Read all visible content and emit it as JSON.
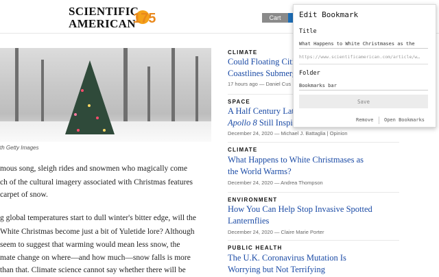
{
  "header": {
    "logo_line1": "SCIENTIFIC",
    "logo_line2": "AMERICAN",
    "logo_badge": "175",
    "cart_label": "Cart"
  },
  "article": {
    "caption": "th Getty Images",
    "paragraph1": [
      "mous song, sleigh rides and snowmen who magically come",
      "ch of the cultural imagery associated with Christmas features",
      "carpet of snow."
    ],
    "paragraph2": [
      "g global temperatures start to dull winter's bitter edge, will the",
      "White Christmas become just a bit of Yuletide lore? Although",
      "seem to suggest that warming would mean less snow, the",
      "mate change on where—and how much—snow falls is more",
      "than that. Climate science cannot say whether there will be"
    ]
  },
  "sidebar": {
    "items": [
      {
        "kicker": "CLIMATE",
        "headline": "Could Floating Citi… Coastlines Submerg…",
        "line1": "Could Floating Citi",
        "line2": "Coastlines Submerg",
        "meta": "17 hours ago — Daniel Cus"
      },
      {
        "kicker": "SPACE",
        "line1": "A Half Century Late",
        "line2a": "Apollo 8",
        "line2b": " Still Inspire",
        "meta": "December 24, 2020 — Michael J. Battaglia | Opinion"
      },
      {
        "kicker": "CLIMATE",
        "line1": "What Happens to White Christmases as",
        "line2": "the World Warms?",
        "meta": "December 24, 2020 — Andrea Thompson"
      },
      {
        "kicker": "ENVIRONMENT",
        "line1": "How You Can Help Stop Invasive Spotted",
        "line2": "Lanternflies",
        "meta": "December 24, 2020 — Claire Marie Porter"
      },
      {
        "kicker": "PUBLIC HEALTH",
        "line1": "The U.K. Coronavirus Mutation Is",
        "line2": "Worrying but Not Terrifying",
        "meta": ""
      }
    ]
  },
  "bookmark_popup": {
    "title": "Edit Bookmark",
    "title_label": "Title",
    "title_value": "What Happens to White Christmases as the",
    "url_value": "https://www.scientificamerican.com/article/w…",
    "folder_label": "Folder",
    "folder_value": "Bookmarks bar",
    "save_label": "Save",
    "remove_label": "Remove",
    "open_label": "Open Bookmarks"
  },
  "colors": {
    "link": "#1a4aa5",
    "logo_accent": "#f4a21a",
    "cart_bg": "#8a8a8a"
  }
}
